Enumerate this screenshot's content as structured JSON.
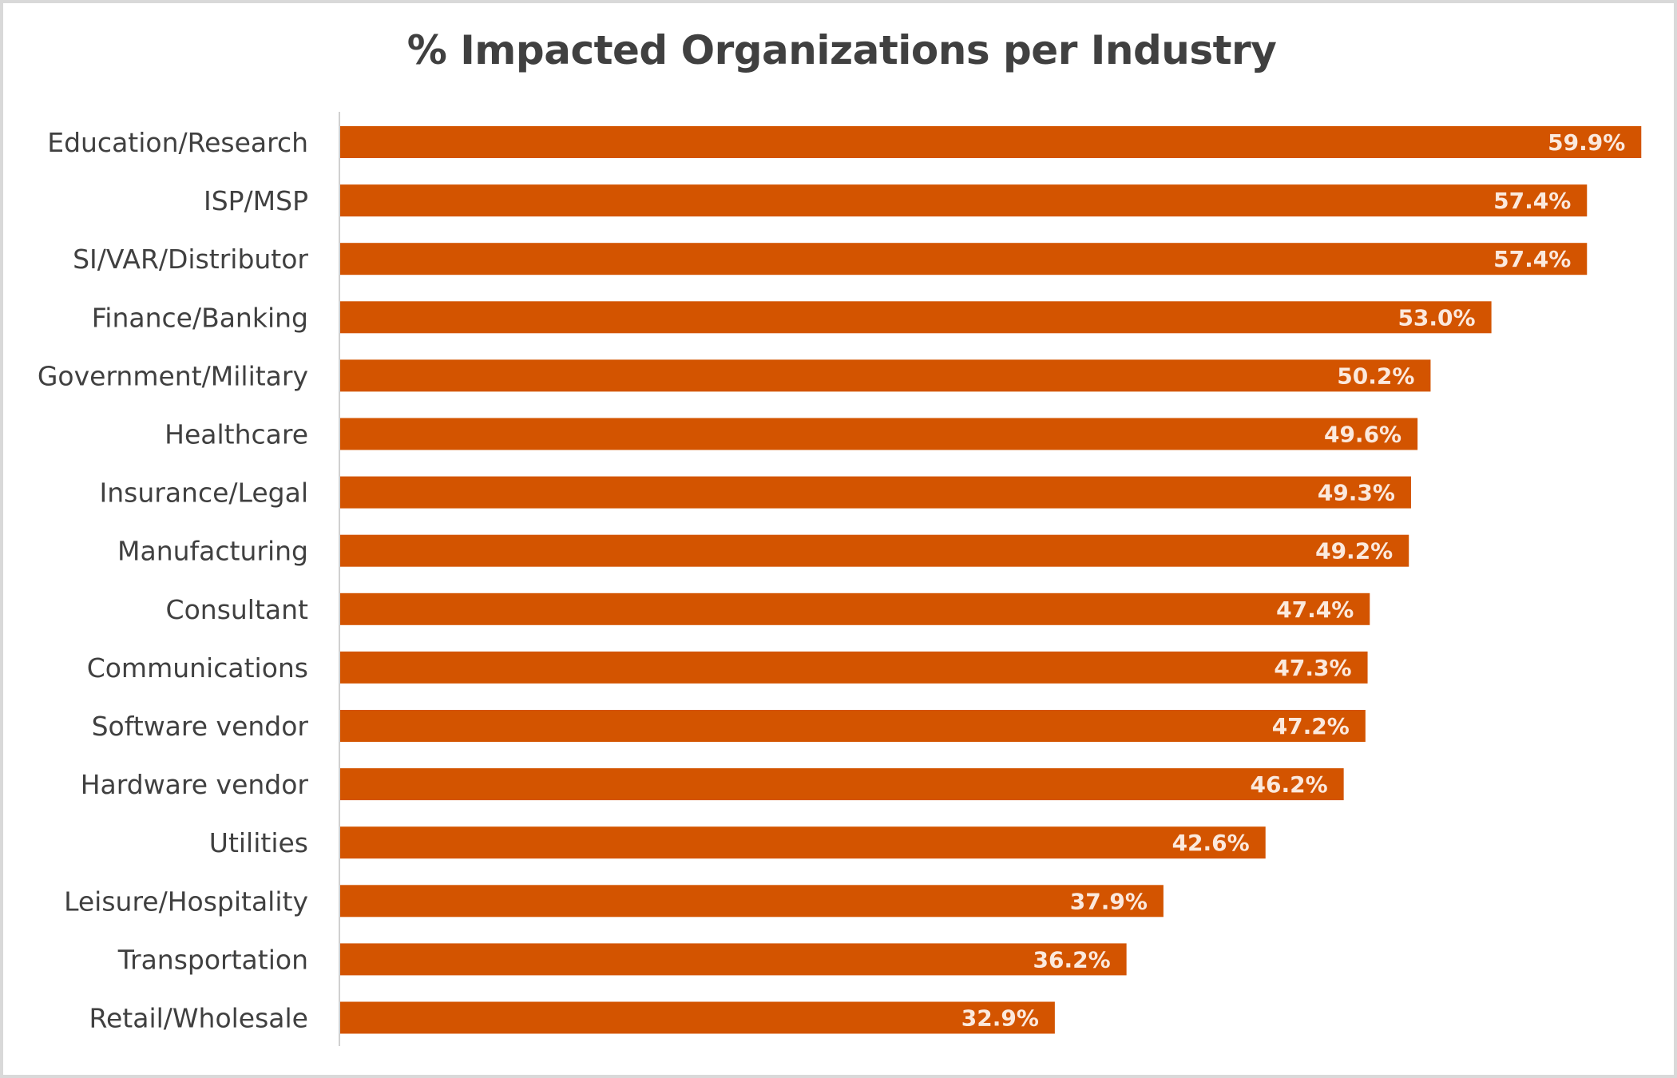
{
  "chart_data": {
    "type": "bar",
    "orientation": "horizontal",
    "title": "% Impacted Organizations per Industry",
    "xlabel": "",
    "ylabel": "",
    "categories": [
      "Education/Research",
      "ISP/MSP",
      "SI/VAR/Distributor",
      "Finance/Banking",
      "Government/Military",
      "Healthcare",
      "Insurance/Legal",
      "Manufacturing",
      "Consultant",
      "Communications",
      "Software vendor",
      "Hardware vendor",
      "Utilities",
      "Leisure/Hospitality",
      "Transportation",
      "Retail/Wholesale"
    ],
    "values": [
      59.9,
      57.4,
      57.4,
      53.0,
      50.2,
      49.6,
      49.3,
      49.2,
      47.4,
      47.3,
      47.2,
      46.2,
      42.6,
      37.9,
      36.2,
      32.9
    ],
    "value_labels": [
      "59.9%",
      "57.4%",
      "57.4%",
      "53.0%",
      "50.2%",
      "49.6%",
      "49.3%",
      "49.2%",
      "47.4%",
      "47.3%",
      "47.2%",
      "46.2%",
      "42.6%",
      "37.9%",
      "36.2%",
      "32.9%"
    ],
    "unit": "%",
    "xlim": [
      0,
      60
    ],
    "grid": false,
    "legend": "none",
    "bar_color": "#d35400",
    "label_color": "#fbe9dd",
    "text_color": "#404040"
  }
}
